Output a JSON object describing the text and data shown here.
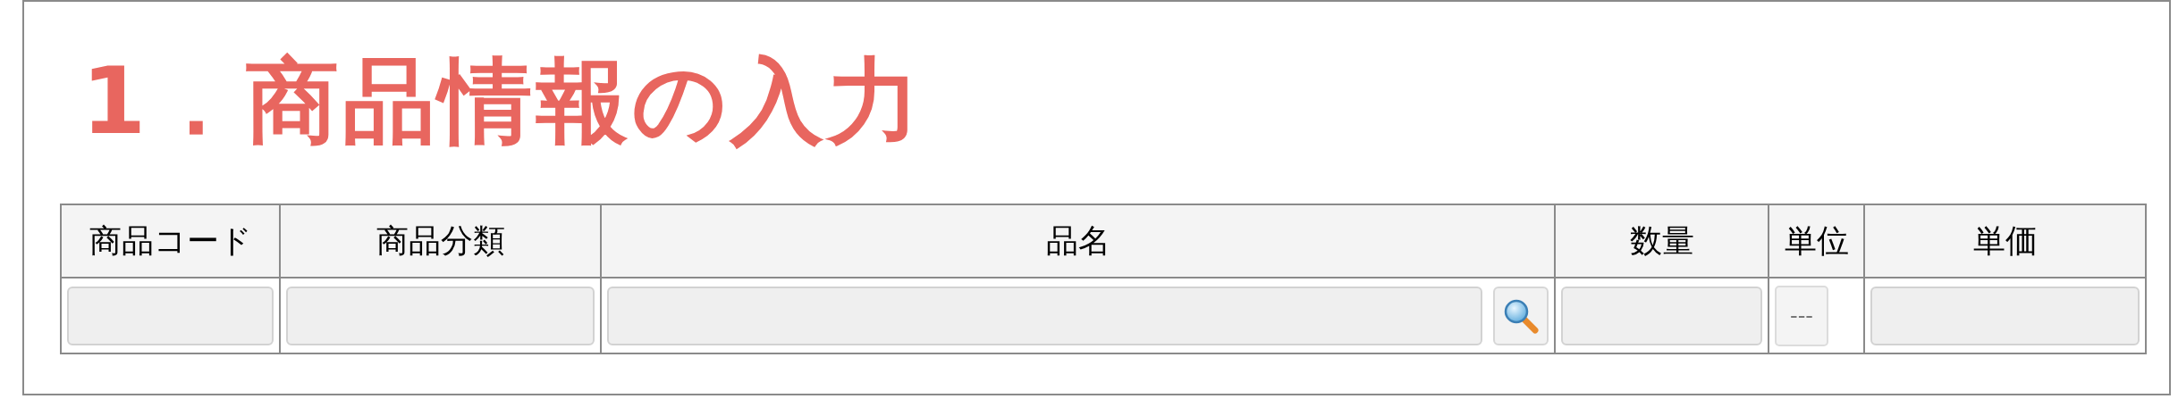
{
  "heading": "1．商品情報の入力",
  "table": {
    "columns": [
      "商品コード",
      "商品分類",
      "品名",
      "数量",
      "単位",
      "単価"
    ],
    "row": {
      "product_code": {
        "kind": "input"
      },
      "category": {
        "kind": "input"
      },
      "name": {
        "kind": "input_search"
      },
      "quantity": {
        "kind": "input"
      },
      "unit": {
        "kind": "select",
        "value": "---"
      },
      "price": {
        "kind": "input"
      }
    }
  }
}
